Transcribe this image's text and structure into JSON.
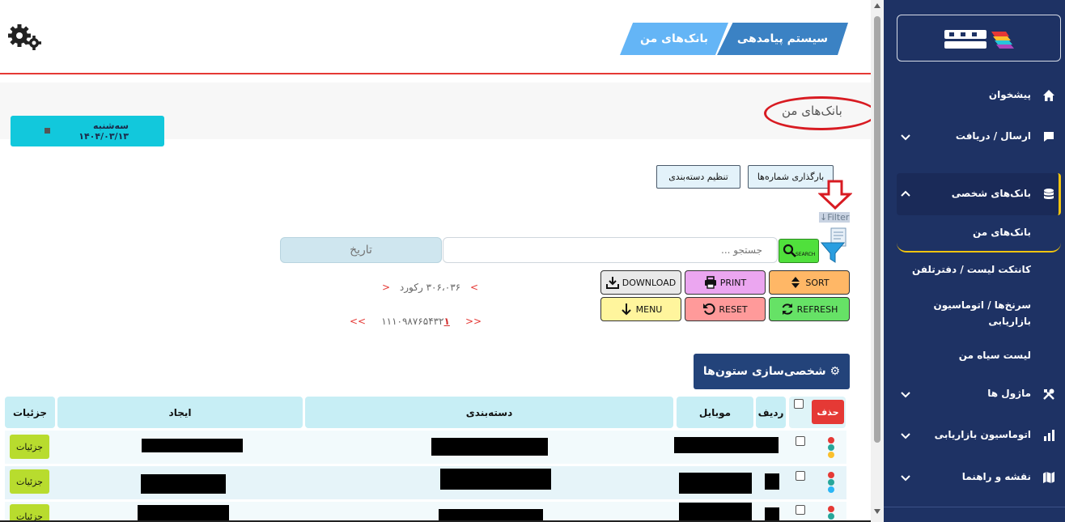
{
  "sidebar": {
    "logo_text": "HOMA",
    "items": [
      {
        "label": "پیشخوان",
        "icon": "home-icon"
      },
      {
        "label": "ارسال / دریافت",
        "icon": "message-icon"
      },
      {
        "label": "بانک‌های شخصی",
        "icon": "database-icon"
      },
      {
        "label": "ماژول ها",
        "icon": "tools-icon"
      },
      {
        "label": "اتوماسیون بازاریابی",
        "icon": "chart-icon"
      },
      {
        "label": "نقشه و راهنما",
        "icon": "map-icon"
      }
    ],
    "sub_items": [
      {
        "label": "بانک‌های من"
      },
      {
        "label": "کانتکت لیست / دفترتلفن"
      },
      {
        "label": "سرنخ‌ها / اتوماسیون بازاریابی"
      },
      {
        "label": "لیست سیاه من"
      }
    ]
  },
  "header": {
    "breadcrumb_1": "سیستم پیامدهی",
    "breadcrumb_2": "بانک‌های من"
  },
  "page": {
    "title": "بانک‌های من",
    "date_button": "سه‌شنبه ۱۴۰۴/۰۳/۱۳",
    "upload_button": "بارگذاری شماره‌ها",
    "category_button": "تنظیم دسته‌بندی",
    "filter_label": "↓Filter",
    "search_label": "SEARCH",
    "search_placeholder": "جستجو ...",
    "date_placeholder": "تاریخ",
    "buttons": {
      "sort": "SORT",
      "print": "PRINT",
      "download": "DOWNLOAD",
      "refresh": "REFRESH",
      "reset": "RESET",
      "menu": "MENU"
    },
    "record_count": "۳۰۶،۰۳۶ رکورد",
    "prev_arrow": "<",
    "next_arrow": ">",
    "first_arrow": "<<",
    "last_arrow": ">>",
    "pages": "۱۱۱۰۹۸۷۶۵۴۳۲",
    "current_page": "۱",
    "customize_button": "⚙ شخصی‌سازی ستون‌ها"
  },
  "table": {
    "headers": {
      "delete": "حذف",
      "row": "ردیف",
      "mobile": "موبایل",
      "category": "دسته‌بندی",
      "created": "ایجاد",
      "details": "جزئیات"
    },
    "detail_label": "جزئیات",
    "row_count": 3
  },
  "colors": {
    "sidebar_bg": "#1e3264",
    "accent_yellow": "#f1c40f",
    "header_red": "#e53935",
    "crumb_dark": "#3b82c4",
    "crumb_light": "#64b5f6"
  }
}
